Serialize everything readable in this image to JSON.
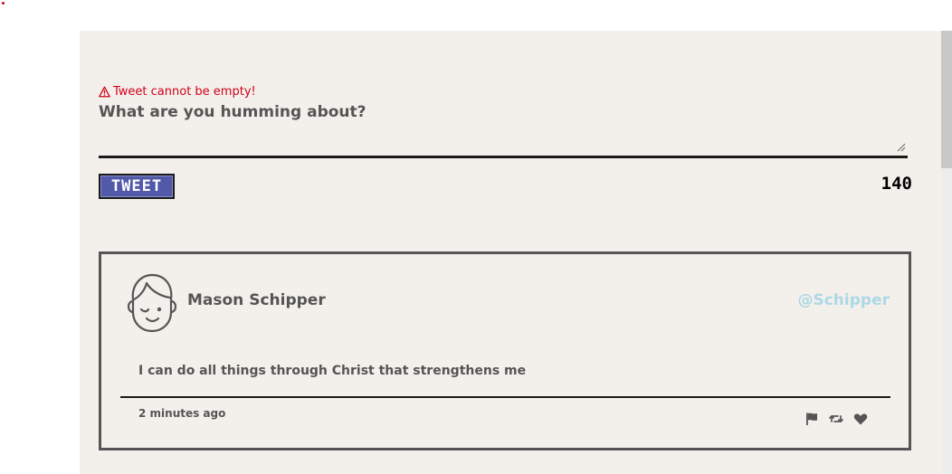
{
  "composer": {
    "error_message": "Tweet cannot be empty!",
    "error_icon": "warning-icon",
    "placeholder": "What are you humming about?",
    "value": "",
    "tweet_button_label": "TWEET",
    "char_count": "140"
  },
  "feed": {
    "tweets": [
      {
        "display_name": "Mason Schipper",
        "handle": "@Schipper",
        "avatar_icon": "winking-face-avatar-icon",
        "text": "I can do all things through Christ that strengthens me",
        "timestamp": "2 minutes ago",
        "actions": [
          "flag-icon",
          "retweet-icon",
          "heart-icon"
        ]
      }
    ]
  },
  "colors": {
    "panel_bg": "#f3f0eb",
    "error": "#d0021b",
    "button_bg": "#5159a8",
    "handle": "#add8e6",
    "text": "#555555"
  }
}
